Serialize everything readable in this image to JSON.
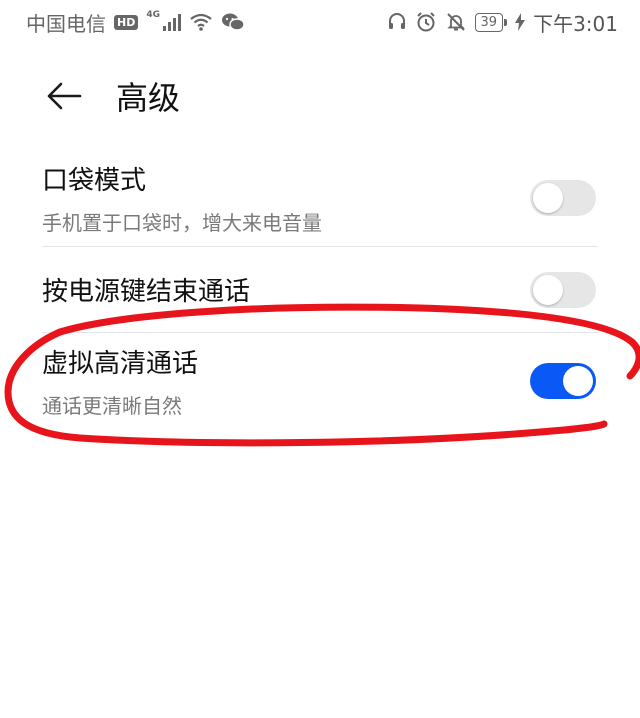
{
  "status_bar": {
    "carrier": "中国电信",
    "hd_badge": "HD",
    "network_type": "4G",
    "battery_level": "39",
    "time": "下午3:01"
  },
  "header": {
    "title": "高级"
  },
  "settings": [
    {
      "title": "口袋模式",
      "subtitle": "手机置于口袋时，增大来电音量",
      "enabled": false
    },
    {
      "title": "按电源键结束通话",
      "subtitle": "",
      "enabled": false
    },
    {
      "title": "虚拟高清通话",
      "subtitle": "通话更清晰自然",
      "enabled": true
    }
  ],
  "colors": {
    "toggle_on": "#0a59f7",
    "toggle_off": "#e6e6e6",
    "annotation_stroke": "#e8141b"
  }
}
